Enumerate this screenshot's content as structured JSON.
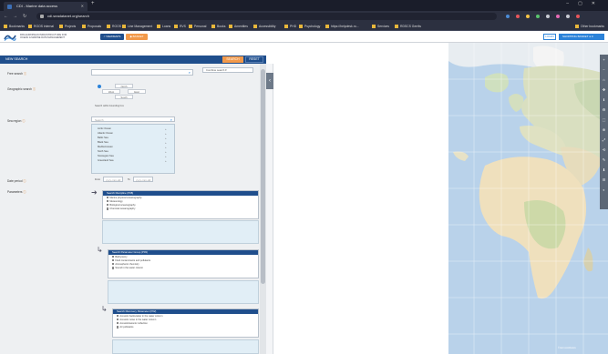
{
  "browser": {
    "tab_title": "CDI - Marine data access",
    "url": "cdi.seadatanet.org/search",
    "bookmarks": [
      "Bookmarks",
      "ROOS internal",
      "Projects",
      "Proposals",
      "ROOS",
      "Line Management",
      "Loans",
      "RVS",
      "Personal",
      "Books",
      "Amenities",
      "Accessibility",
      "PHD",
      "Psychology",
      "https://helpdesk.ro...",
      "Services",
      "RDSCS Gerrits",
      "Other bookmarks"
    ]
  },
  "header": {
    "org_line1": "PAN-EUROPEAN INFRASTRUCTURE FOR",
    "org_line2": "OCEAN & MARINE DATA MANAGEMENT",
    "map_button": "< VIEWMAPS",
    "tag_button": "◆ BASKET",
    "login_button": "LOGIN",
    "basket_button": "SHOPPING BASKET ● 0"
  },
  "toolbar": {
    "new_search": "NEW SEARCH",
    "search": "SEARCH",
    "reset": "RESET"
  },
  "form": {
    "free_search_label": "Free search",
    "free_search_placeholder": "",
    "combine_select": "Combine search ▾",
    "geo_label": "Geographic search",
    "geo_box_n": "North",
    "geo_box_w": "West",
    "geo_box_e": "East",
    "geo_box_s": "South",
    "geo_note": "Search within bounding box",
    "sea_region_label": "Sea region",
    "sea_region_placeholder": "Search",
    "sea_regions": [
      "Arctic Ocean",
      "Atlantic Ocean",
      "Baltic Sea",
      "Black Sea",
      "Mediterranean",
      "North Sea",
      "Norwegian Sea",
      "Greenland Sea"
    ],
    "date_label": "Date period",
    "date_from_label": "From",
    "date_from_placeholder": "yyyy-mm-dd",
    "date_to_label": "To",
    "date_to_placeholder": "yyyy-mm-dd",
    "params_label": "Parameters",
    "disc_header": "Search Discipline (P08)",
    "disc_items": [
      "Marine physical oceanography",
      "Meteorology",
      "Biological oceanography",
      "Chemical oceanography"
    ],
    "group_header": "Search Parameter Group (P03)",
    "group_items": [
      "Bathymetry",
      "Fluid contaminants and pollutants",
      "Atmospheric chemistry",
      "Sound in the water column"
    ],
    "disc2_header": "Search Discovery Parameter (P02)",
    "disc2_items": [
      "Acoustic backscatter in the water column",
      "Acoustic noise in the water column",
      "Acoustic/seismic reflection",
      "Air pollutants"
    ]
  },
  "map": {
    "controls": [
      "+",
      "−",
      "⌂",
      "✥",
      "ℹ",
      "⚙",
      "⬚",
      "⊕",
      "⤢",
      "⟲",
      "✎",
      "⬇",
      "☰",
      "◐"
    ],
    "copyright": "© Esri contributors"
  }
}
